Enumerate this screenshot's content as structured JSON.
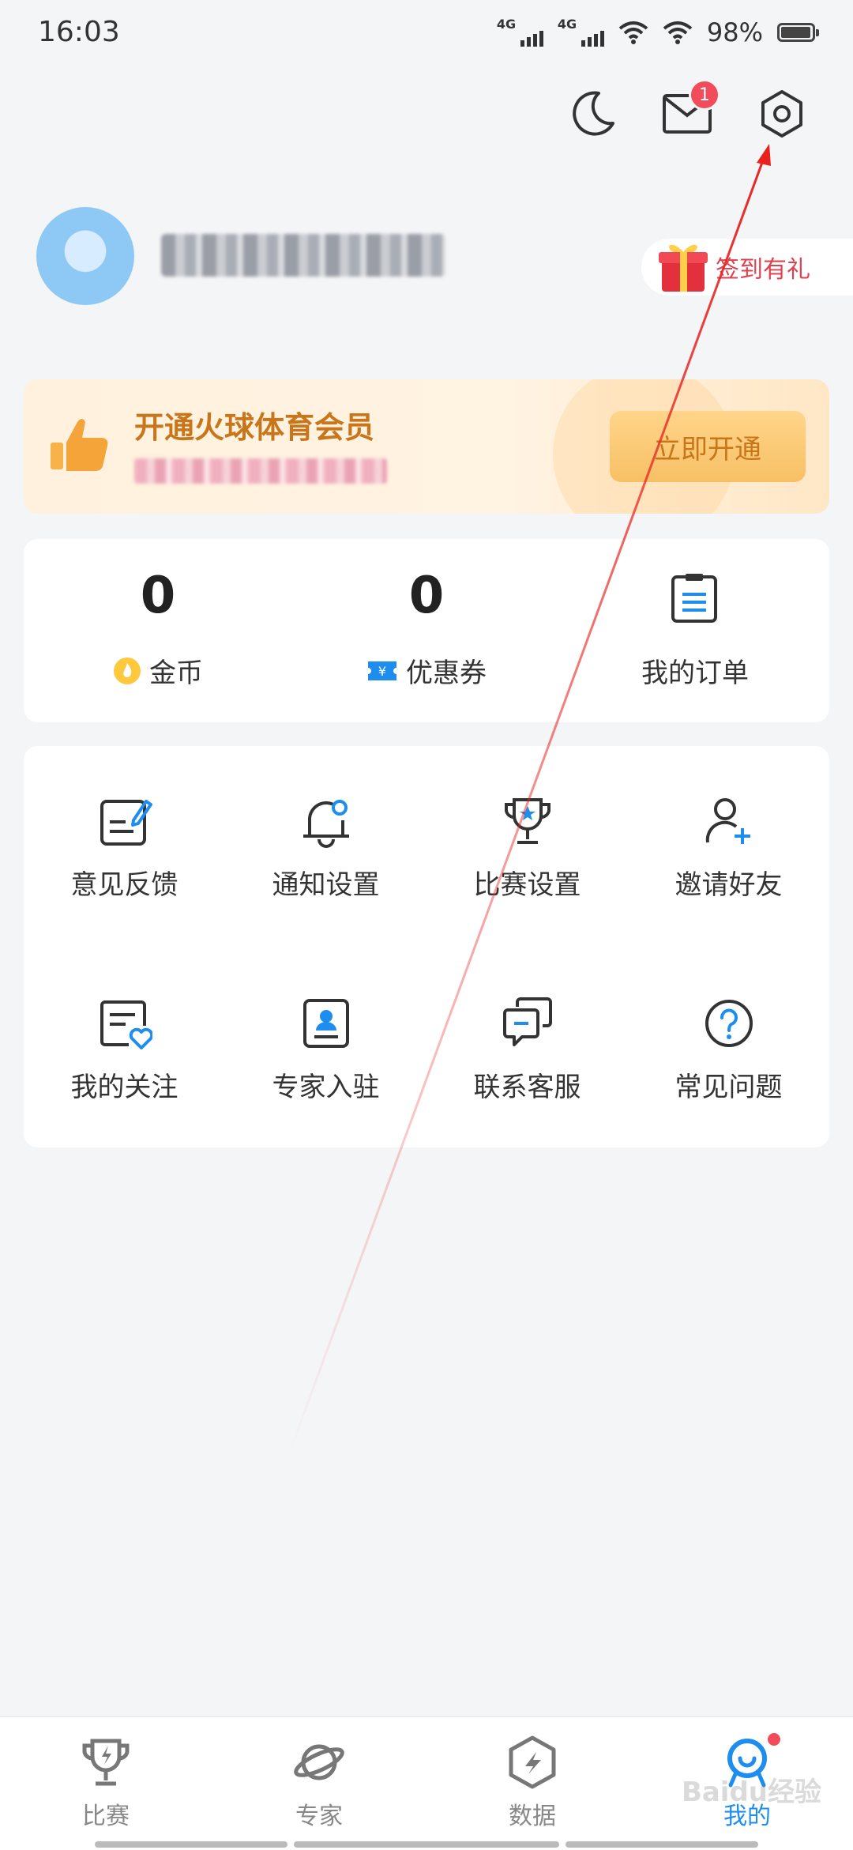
{
  "status_bar": {
    "time": "16:03",
    "network1": "4G",
    "network2": "4G",
    "battery_percent": "98%",
    "battery_level": 0.98
  },
  "header": {
    "icons": [
      "moon-icon",
      "mail-icon",
      "settings-icon"
    ],
    "mail_badge": "1"
  },
  "profile": {
    "signin_label": "签到有礼"
  },
  "vip": {
    "title": "开通火球体育会员",
    "button_label": "立即开通"
  },
  "stats": {
    "coins_value": "0",
    "coins_label": "金币",
    "coupons_value": "0",
    "coupons_label": "优惠券",
    "orders_label": "我的订单"
  },
  "menu": {
    "items": [
      {
        "label": "意见反馈",
        "icon": "feedback-icon"
      },
      {
        "label": "通知设置",
        "icon": "bell-icon"
      },
      {
        "label": "比赛设置",
        "icon": "trophy-icon"
      },
      {
        "label": "邀请好友",
        "icon": "add-user-icon"
      },
      {
        "label": "我的关注",
        "icon": "follow-icon"
      },
      {
        "label": "专家入驻",
        "icon": "expert-badge-icon"
      },
      {
        "label": "联系客服",
        "icon": "chat-icon"
      },
      {
        "label": "常见问题",
        "icon": "question-icon"
      }
    ]
  },
  "bottom_nav": {
    "items": [
      {
        "label": "比赛",
        "icon": "trophy-icon"
      },
      {
        "label": "专家",
        "icon": "planet-icon"
      },
      {
        "label": "数据",
        "icon": "data-hex-icon"
      },
      {
        "label": "我的",
        "icon": "profile-mascot-icon"
      }
    ],
    "active_index": 3
  },
  "watermark": "Baidu经验",
  "colors": {
    "accent_blue": "#1d8ef0",
    "badge_red": "#f24b5a",
    "vip_orange": "#c9751a",
    "annotation_red": "#e8231f"
  }
}
